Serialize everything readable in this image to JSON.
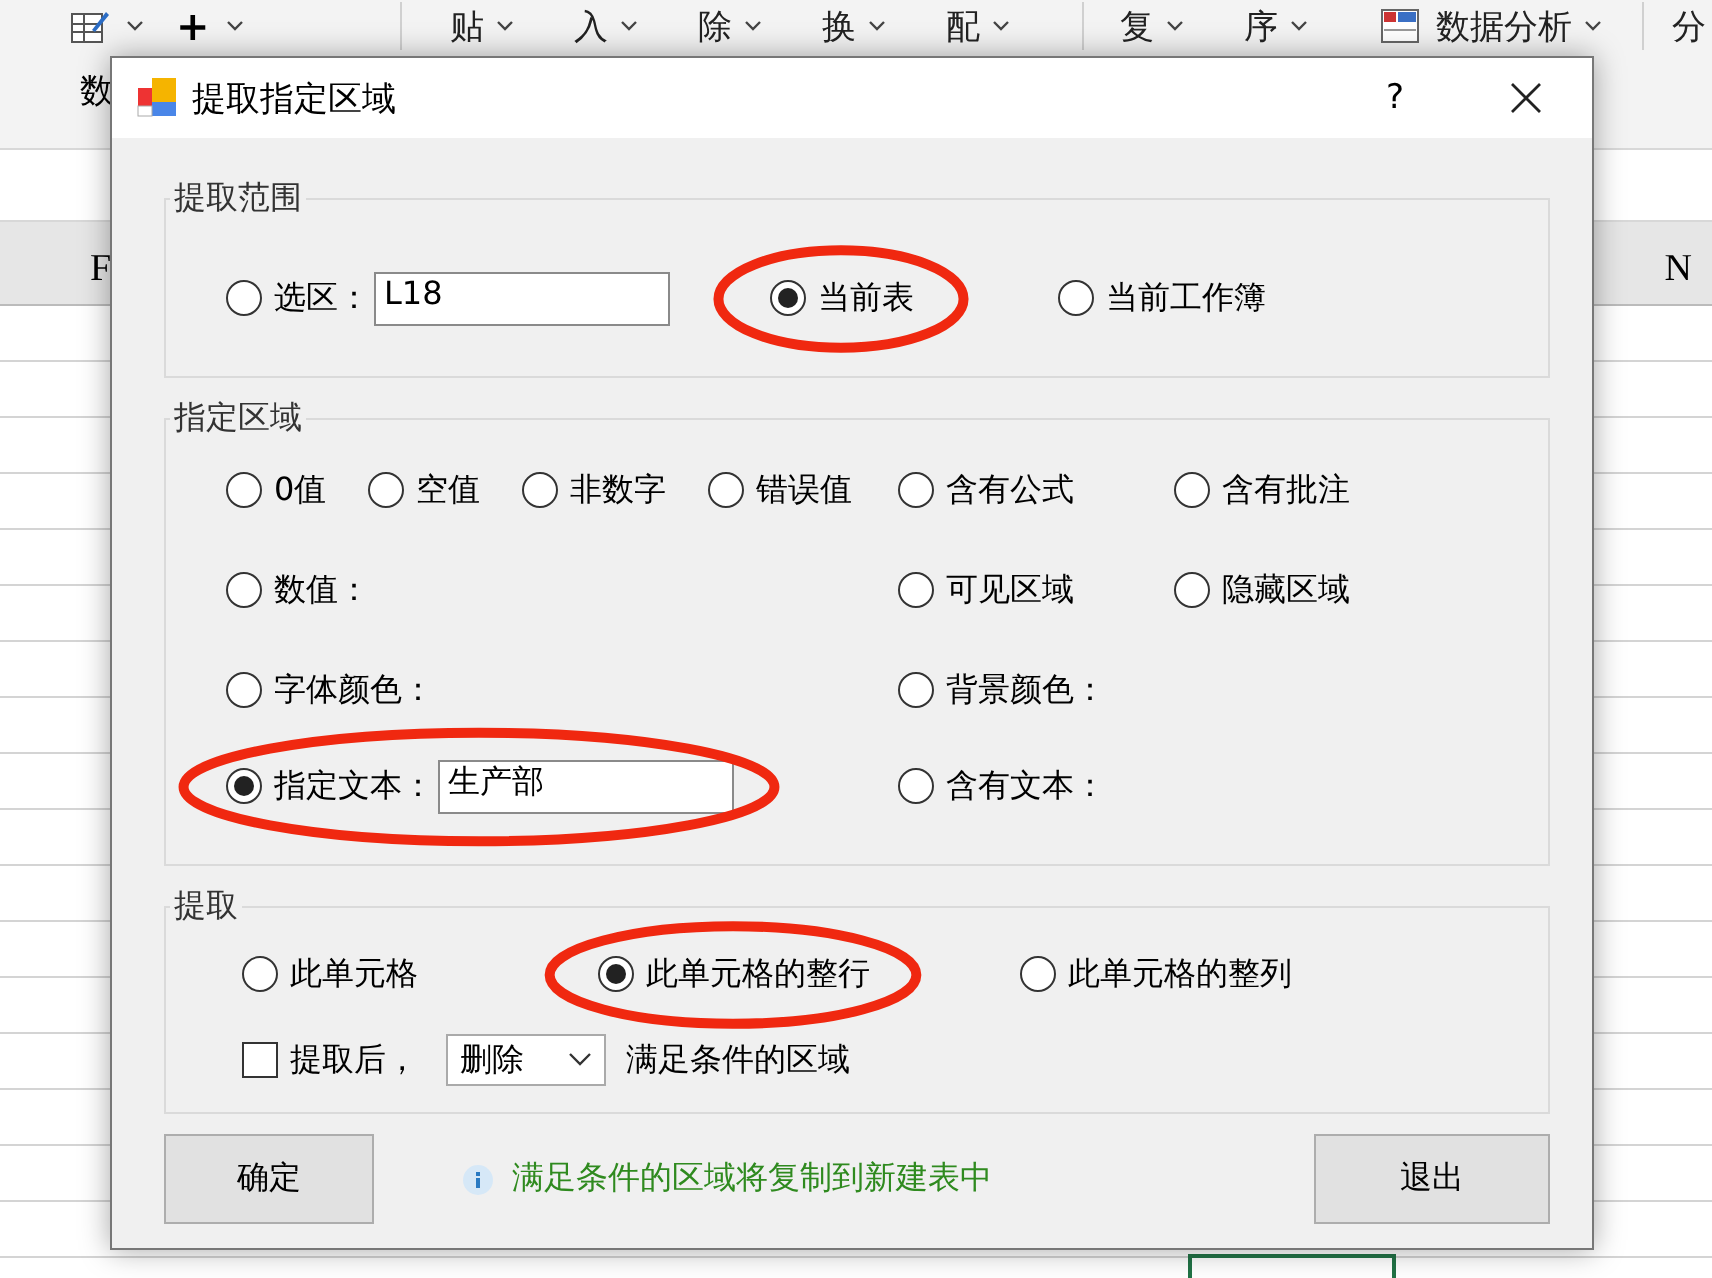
{
  "ribbon": {
    "small_buttons": [
      {
        "kind": "table-icon"
      },
      {
        "kind": "text",
        "label": "+"
      }
    ],
    "group_label": "数",
    "groups": [
      [
        {
          "label": "贴"
        },
        {
          "label": "入"
        },
        {
          "label": "除"
        },
        {
          "label": "换"
        },
        {
          "label": "配"
        }
      ],
      [
        {
          "label": "复"
        },
        {
          "label": "序"
        },
        {
          "label": "数据分析",
          "icon": true
        }
      ],
      [
        {
          "label": "分",
          "cut": true
        }
      ]
    ]
  },
  "sheet": {
    "column_headers": [
      {
        "label": "F"
      },
      {
        "label": "N"
      }
    ]
  },
  "dialog": {
    "title": "提取指定区域",
    "help": "?",
    "groups": [
      {
        "title": "提取范围",
        "kind": "scope",
        "options": [
          {
            "label": "选区：",
            "selected": false,
            "highlighted": false,
            "field": "L18"
          },
          {
            "label": "当前表",
            "selected": true,
            "highlighted": true
          },
          {
            "label": "当前工作簿",
            "selected": false,
            "highlighted": false
          }
        ]
      },
      {
        "title": "指定区域",
        "kind": "criteria",
        "rows": [
          {
            "left": [
              {
                "label": "0值",
                "selected": false,
                "highlighted": false
              },
              {
                "label": "空值",
                "selected": false,
                "highlighted": false
              },
              {
                "label": "非数字",
                "selected": false,
                "highlighted": false
              },
              {
                "label": "错误值",
                "selected": false,
                "highlighted": false
              }
            ],
            "right": [
              {
                "label": "含有公式",
                "selected": false,
                "highlighted": false
              },
              {
                "label": "含有批注",
                "selected": false,
                "highlighted": false
              }
            ]
          },
          {
            "left": [
              {
                "label": "数值：",
                "selected": false,
                "highlighted": false
              }
            ],
            "right": [
              {
                "label": "可见区域",
                "selected": false,
                "highlighted": false
              },
              {
                "label": "隐藏区域",
                "selected": false,
                "highlighted": false
              }
            ]
          },
          {
            "left": [
              {
                "label": "字体颜色：",
                "selected": false,
                "highlighted": false
              }
            ],
            "right": [
              {
                "label": "背景颜色：",
                "selected": false,
                "highlighted": false
              }
            ]
          },
          {
            "left": [
              {
                "label": "指定文本：",
                "selected": true,
                "highlighted": true,
                "field": "生产部"
              }
            ],
            "right": [
              {
                "label": "含有文本：",
                "selected": false,
                "highlighted": false
              }
            ]
          }
        ]
      },
      {
        "title": "提取",
        "kind": "action",
        "options": [
          {
            "label": "此单元格",
            "selected": false,
            "highlighted": false
          },
          {
            "label": "此单元格的整行",
            "selected": true,
            "highlighted": true
          },
          {
            "label": "此单元格的整列",
            "selected": false,
            "highlighted": false
          }
        ],
        "after": {
          "checked": false,
          "label": "提取后，",
          "select": "删除",
          "suffix": "满足条件的区域"
        }
      }
    ],
    "ok_button": "确定",
    "info": "满足条件的区域将复制到新建表中",
    "exit_button": "退出"
  }
}
